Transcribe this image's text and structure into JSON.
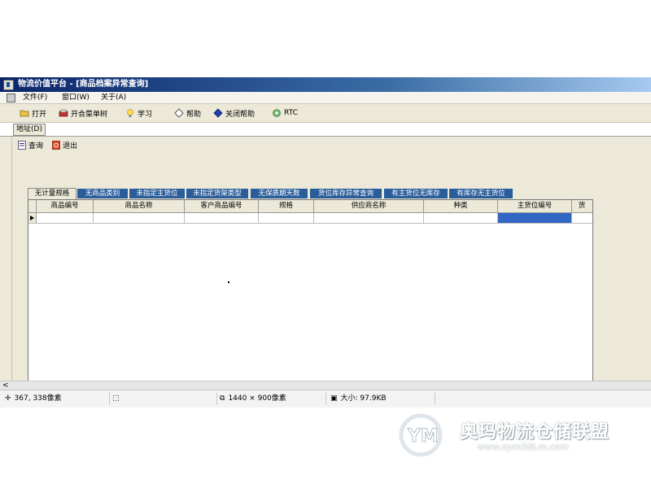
{
  "window": {
    "title": "物流价值平台 - [商品档案异常查询]"
  },
  "menu": [
    "文件(F)",
    "窗口(W)",
    "关于(A)"
  ],
  "toolbar": {
    "open": "打开",
    "toggle_menu_tree": "开合菜单树",
    "learn": "学习",
    "help": "帮助",
    "close_help": "关闭帮助",
    "rtc": "RTC"
  },
  "address": {
    "label": "地址(D)"
  },
  "actions": {
    "query": "查询",
    "exit": "退出"
  },
  "tabs": [
    "无计量规格",
    "无商品类别",
    "未指定主货位",
    "未指定货架类型",
    "无保质期天数",
    "货位库存异常查询",
    "有主货位无库存",
    "有库存无主货位"
  ],
  "active_tab_index": 0,
  "grid": {
    "columns": [
      "商品编号",
      "商品名称",
      "客户商品编号",
      "规格",
      "供应商名称",
      "种类",
      "主货位编号",
      "货"
    ],
    "rows": [
      [
        "",
        "",
        "",
        "",
        "",
        "",
        "",
        ""
      ]
    ]
  },
  "status": {
    "coords": "367, 338像素",
    "dimensions": "1440 × 900像素",
    "size": "大小: 97.9KB"
  },
  "watermark": {
    "text": "奥玛物流仓储联盟",
    "url": "www.oym56Lm.com"
  },
  "colors": {
    "title_bar": "#0a246a",
    "tab_bg": "#2a5d9a",
    "selection": "#3166c4",
    "chrome": "#ece9d8"
  }
}
